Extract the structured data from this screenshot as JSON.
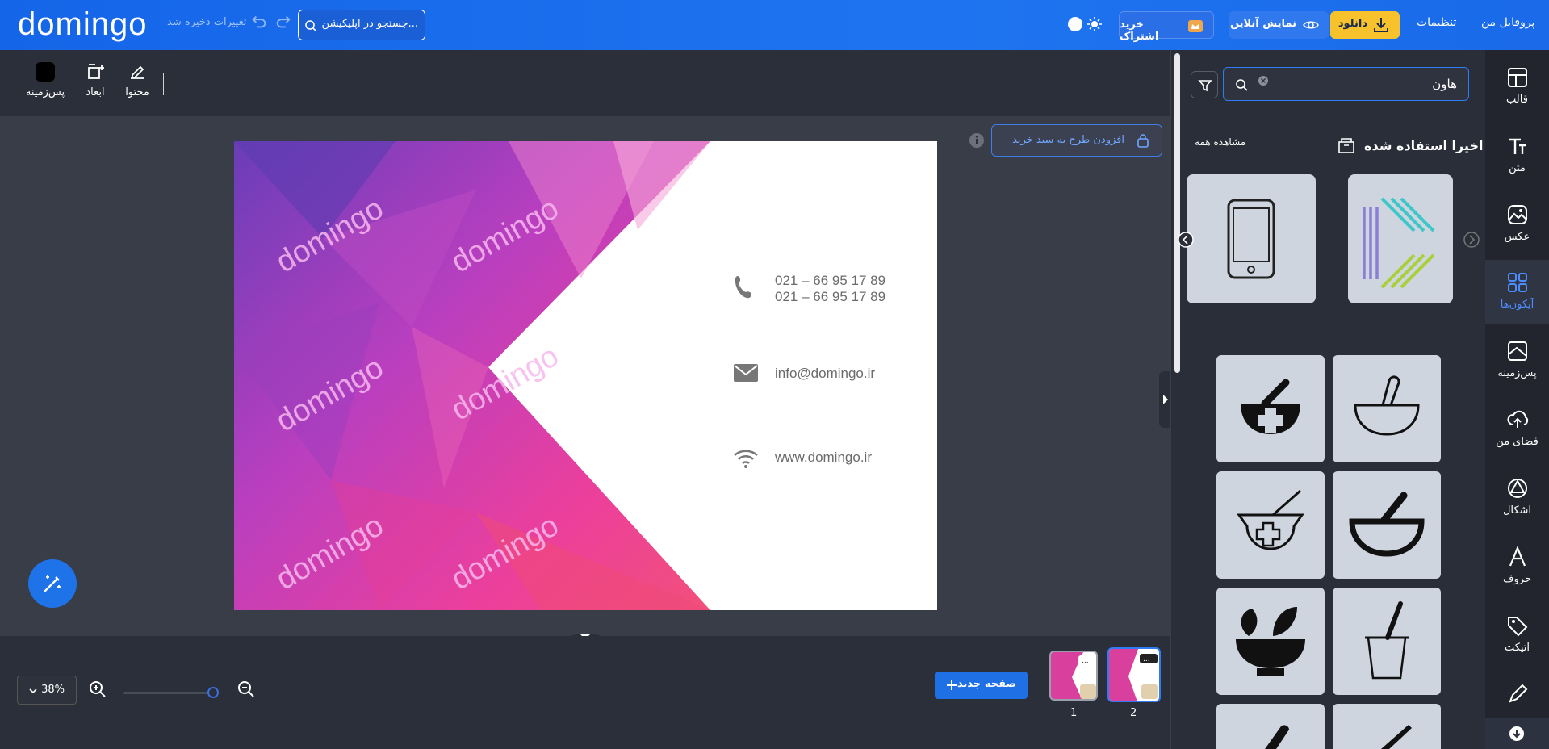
{
  "header": {
    "logo": "domingo",
    "save_status": "تغییرات ذخیره شد",
    "search_placeholder": "جستجو در اپلیکیشن...",
    "subscribe": "خرید اشتراک",
    "preview": "نمایش آنلاین",
    "download": "دانلود",
    "settings": "تنظیمات",
    "profile": "پروفایل من"
  },
  "editor_tools": {
    "content": "محتوا",
    "dimensions": "ابعاد",
    "background": "پس‌زمینه"
  },
  "canvas": {
    "add_to_cart": "افزودن طرح به سبد خرید",
    "watermark_text": "domingo",
    "phone_line_1": "021 – 66 95 17 89",
    "phone_line_2": "021 – 66 95 17 89",
    "email": "info@domingo.ir",
    "website": "www.domingo.ir"
  },
  "bottom": {
    "zoom": "38%",
    "new_page": "صفحه جدید",
    "pages": [
      {
        "number": "1"
      },
      {
        "number": "2"
      }
    ]
  },
  "panel": {
    "search_value": "هاون",
    "recent_title": "اخیرا استفاده شده",
    "see_all": "مشاهده همه"
  },
  "sidenav": [
    {
      "label": "قالب",
      "icon": "template-icon"
    },
    {
      "label": "متن",
      "icon": "text-icon"
    },
    {
      "label": "عکس",
      "icon": "photo-icon"
    },
    {
      "label": "آیکون‌ها",
      "icon": "icons-grid-icon",
      "active": true
    },
    {
      "label": "پس‌زمینه",
      "icon": "background-icon"
    },
    {
      "label": "فضای من",
      "icon": "cloud-upload-icon"
    },
    {
      "label": "اشکال",
      "icon": "shapes-icon"
    },
    {
      "label": "حروف",
      "icon": "letters-icon"
    },
    {
      "label": "اتیکت",
      "icon": "tag-icon"
    }
  ],
  "colors": {
    "accent": "#1e73e8",
    "download_yellow": "#f7c22b",
    "card_pink": "#e8389a"
  }
}
